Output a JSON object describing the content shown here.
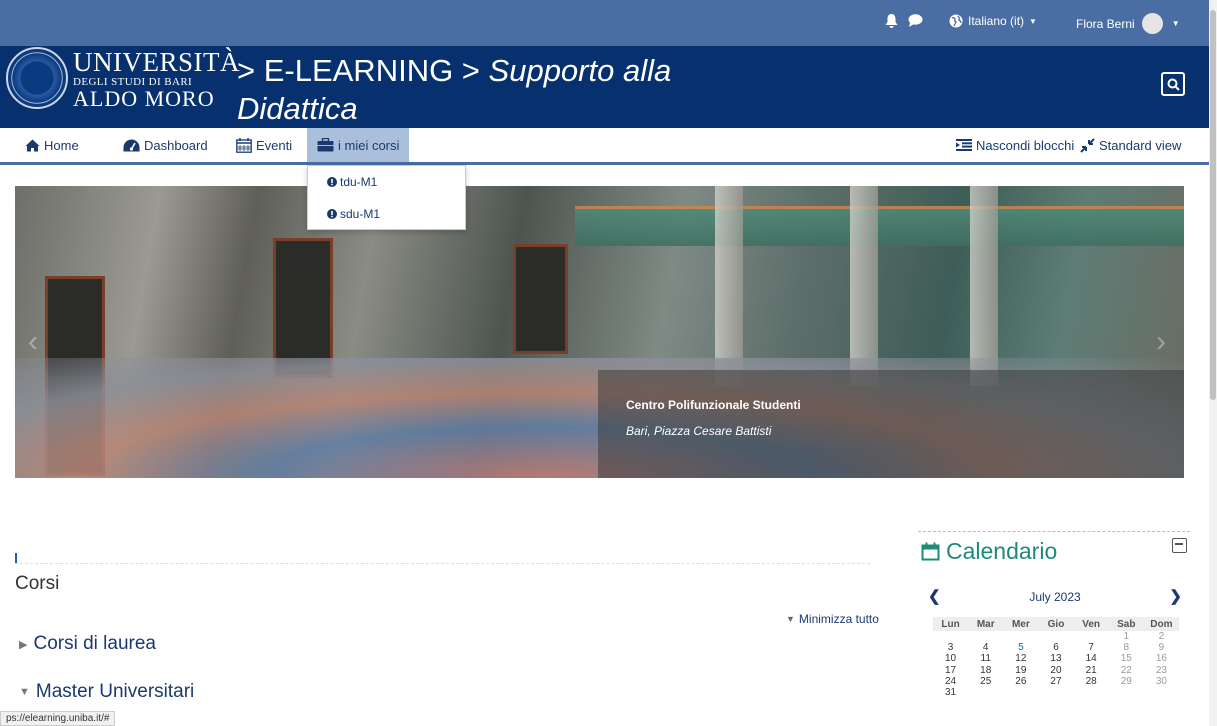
{
  "topbar": {
    "notification_icon": "bell-icon",
    "messages_icon": "chat-bubble-icon",
    "language": "Italiano (it)",
    "user_name": "Flora Berni"
  },
  "banner": {
    "logo_line1": "UNIVERSITÀ",
    "logo_line2": "DEGLI STUDI DI BARI",
    "logo_line3": "ALDO MORO",
    "title_part1": "> E-LEARNING > ",
    "title_part2": "Supporto alla Didattica"
  },
  "nav": {
    "home": "Home",
    "dashboard": "Dashboard",
    "events": "Eventi",
    "my_courses": "i miei corsi",
    "hide_blocks": "Nascondi blocchi",
    "standard_view": "Standard view"
  },
  "dropdown": {
    "items": [
      {
        "label": "tdu-M1"
      },
      {
        "label": "sdu-M1"
      }
    ]
  },
  "carousel": {
    "caption_title": "Centro Polifunzionale Studenti",
    "caption_subtitle": "Bari, Piazza Cesare Battisti"
  },
  "courses": {
    "title": "Corsi",
    "collapse_all": "Minimizza tutto",
    "categories": [
      {
        "label": "Corsi di laurea",
        "expanded": false
      },
      {
        "label": "Master Universitari",
        "expanded": true
      }
    ]
  },
  "calendar": {
    "title": "Calendario",
    "month": "July 2023",
    "days": [
      "Lun",
      "Mar",
      "Mer",
      "Gio",
      "Ven",
      "Sab",
      "Dom"
    ],
    "weeks": [
      [
        "",
        "",
        "",
        "",
        "",
        "1",
        "2"
      ],
      [
        "3",
        "4",
        "5",
        "6",
        "7",
        "8",
        "9"
      ],
      [
        "10",
        "11",
        "12",
        "13",
        "14",
        "15",
        "16"
      ],
      [
        "17",
        "18",
        "19",
        "20",
        "21",
        "22",
        "23"
      ],
      [
        "24",
        "25",
        "26",
        "27",
        "28",
        "29",
        "30"
      ],
      [
        "31",
        "",
        "",
        "",
        "",
        "",
        ""
      ]
    ]
  },
  "status_bar": {
    "url": "ps://elearning.uniba.it/#"
  },
  "colors": {
    "topbar": "#4a6ea3",
    "banner": "#06306e",
    "calendar_accent": "#1e8a7a",
    "link": "#1a3a6e"
  }
}
